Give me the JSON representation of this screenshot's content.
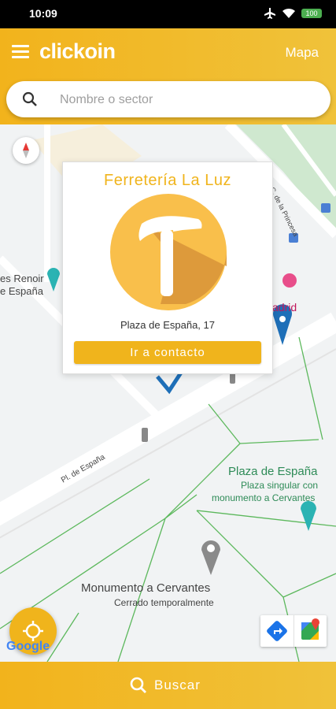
{
  "status": {
    "time": "10:09",
    "battery": "100"
  },
  "app": {
    "brand": "clickoin",
    "map_link": "Mapa"
  },
  "search": {
    "placeholder": "Nombre o sector"
  },
  "popup": {
    "title": "Ferretería La Luz",
    "address": "Plaza de España, 17",
    "button": "Ir a contacto",
    "logo_icon": "hammer-icon"
  },
  "map": {
    "labels": {
      "street_top": "C. de la Princesa",
      "renoir": "es Renoir",
      "renoir2": "e España",
      "madrid": "adrid",
      "pl_espana": "Pl. de España",
      "plaza_title": "Plaza de España",
      "plaza_sub1": "Plaza singular con",
      "plaza_sub2": "monumento a Cervantes",
      "monumento": "Monumento a Cervantes",
      "monumento_sub": "Cerrado temporalmente",
      "google": "Google"
    }
  },
  "bottom": {
    "search_label": "Buscar"
  },
  "colors": {
    "accent": "#f0b41c",
    "map_bg": "#f1f3f4",
    "park_line": "#5cb85c"
  }
}
